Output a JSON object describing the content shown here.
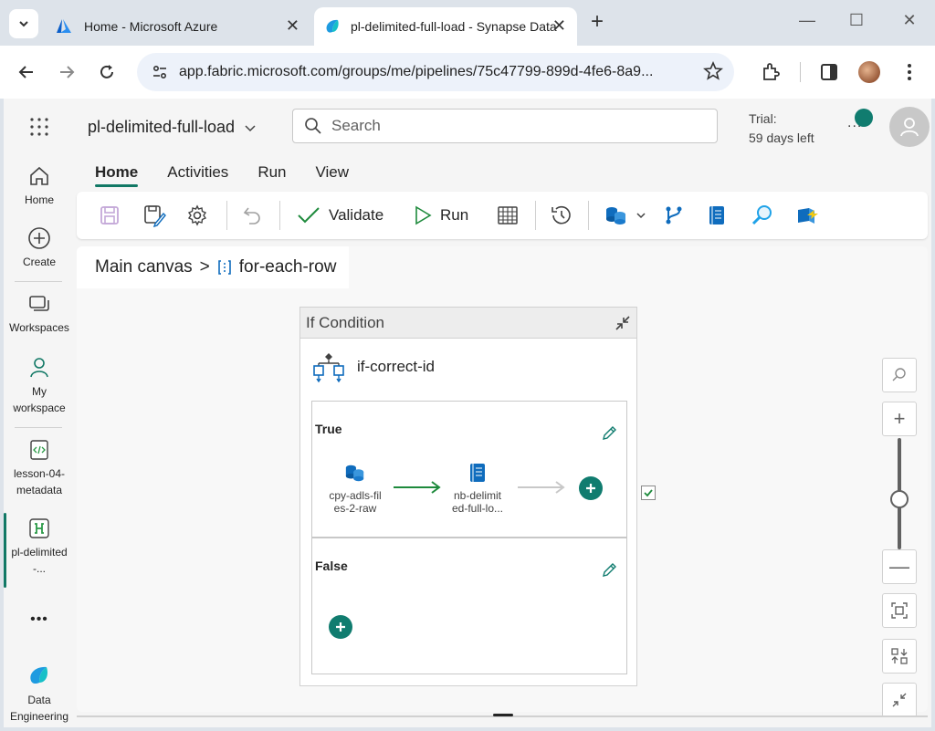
{
  "browser": {
    "tabs": [
      {
        "title": "Home - Microsoft Azure",
        "close": "✕"
      },
      {
        "title": "pl-delimited-full-load - Synapse Data Engineering",
        "close": "✕"
      }
    ],
    "url": "app.fabric.microsoft.com/groups/me/pipelines/75c47799-899d-4fe6-8a9...",
    "new_tab": "+",
    "window_controls": {
      "minimize": "—",
      "maximize": "☐",
      "close": "✕"
    }
  },
  "app": {
    "pipeline_name": "pl-delimited-full-load",
    "search_placeholder": "Search",
    "trial_line1": "Trial:",
    "trial_line2": "59 days left",
    "more": "..."
  },
  "rail": {
    "home": "Home",
    "create": "Create",
    "workspaces": "Workspaces",
    "my_workspace": "My workspace",
    "lesson": "lesson-04-metadata",
    "pipeline": "pl-delimited-...",
    "more": "•••",
    "data_engineering": "Data Engineering"
  },
  "ribbon": {
    "tabs": [
      "Home",
      "Activities",
      "Run",
      "View"
    ],
    "validate": "Validate",
    "run": "Run"
  },
  "canvas": {
    "breadcrumb_root": "Main canvas",
    "breadcrumb_sep": ">",
    "breadcrumb_current": "for-each-row",
    "if_condition": {
      "header": "If Condition",
      "activity_name": "if-correct-id",
      "true_label": "True",
      "false_label": "False",
      "true_nodes": [
        {
          "name": "cpy-adls-files-2-raw",
          "display": "cpy-adls-fil es-2-raw"
        },
        {
          "name": "nb-delimited-full-load",
          "display": "nb-delimit ed-full-lo..."
        }
      ]
    },
    "zoom": {
      "plus": "+",
      "minus": "—",
      "level": 0.45
    }
  },
  "colors": {
    "accent": "#117865",
    "plus_button": "#107c6f",
    "success_arrow": "#1e8a3c",
    "copy_icon": "#0f6cbd"
  }
}
